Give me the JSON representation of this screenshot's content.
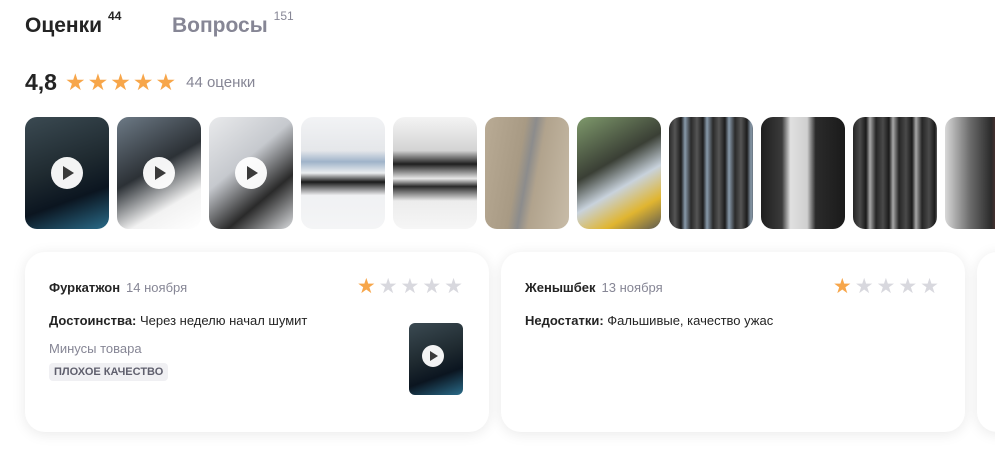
{
  "tabs": [
    {
      "label": "Оценки",
      "count": "44",
      "active": true
    },
    {
      "label": "Вопросы",
      "count": "151",
      "active": false
    }
  ],
  "rating": {
    "score": "4,8",
    "stars_filled": 5,
    "count_text": "44 оценки"
  },
  "photos": [
    {
      "icon": "video-thumbnail",
      "video": true
    },
    {
      "icon": "video-thumbnail",
      "video": true
    },
    {
      "icon": "video-thumbnail",
      "video": true
    },
    {
      "icon": "photo-thumbnail",
      "video": false
    },
    {
      "icon": "photo-thumbnail",
      "video": false
    },
    {
      "icon": "photo-thumbnail",
      "video": false
    },
    {
      "icon": "photo-thumbnail",
      "video": false
    },
    {
      "icon": "photo-thumbnail",
      "video": false
    },
    {
      "icon": "photo-thumbnail",
      "video": false
    },
    {
      "icon": "photo-thumbnail",
      "video": false
    },
    {
      "icon": "photo-thumbnail",
      "video": false
    }
  ],
  "reviews": [
    {
      "author": "Фуркатжон",
      "date": "14 ноября",
      "stars": 1,
      "pros_label": "Достоинства:",
      "pros_text": " Через неделю начал шумит",
      "cons_title": "Минусы товара",
      "tag": "ПЛОХОЕ КАЧЕСТВО",
      "has_video": true
    },
    {
      "author": "Женышбек",
      "date": "13 ноября",
      "stars": 1,
      "cons_label": "Недостатки:",
      "cons_text": " Фальшивые, качество ужас"
    }
  ],
  "colors": {
    "accent_star": "#f7a64a",
    "star_empty": "#d8d8de",
    "muted_text": "#868695"
  }
}
